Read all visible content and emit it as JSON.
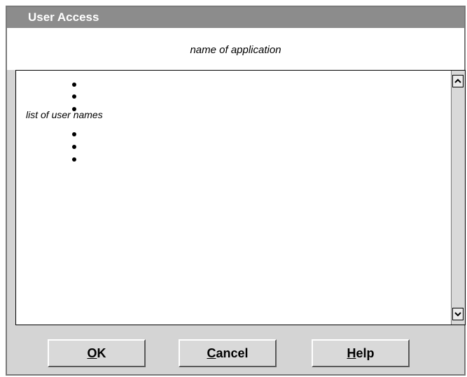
{
  "window": {
    "title": "User Access"
  },
  "header": {
    "subtitle": "name of application"
  },
  "list": {
    "label": "list of user names"
  },
  "buttons": {
    "ok": {
      "mnemonic": "O",
      "rest": "K"
    },
    "cancel": {
      "mnemonic": "C",
      "rest": "ancel"
    },
    "help": {
      "mnemonic": "H",
      "rest": "elp"
    }
  },
  "icons": {
    "scroll_up": "chevron-up-icon",
    "scroll_down": "chevron-down-icon"
  },
  "colors": {
    "titlebar": "#8c8c8c",
    "dialog_background": "#d4d4d4",
    "list_background": "#ffffff"
  }
}
